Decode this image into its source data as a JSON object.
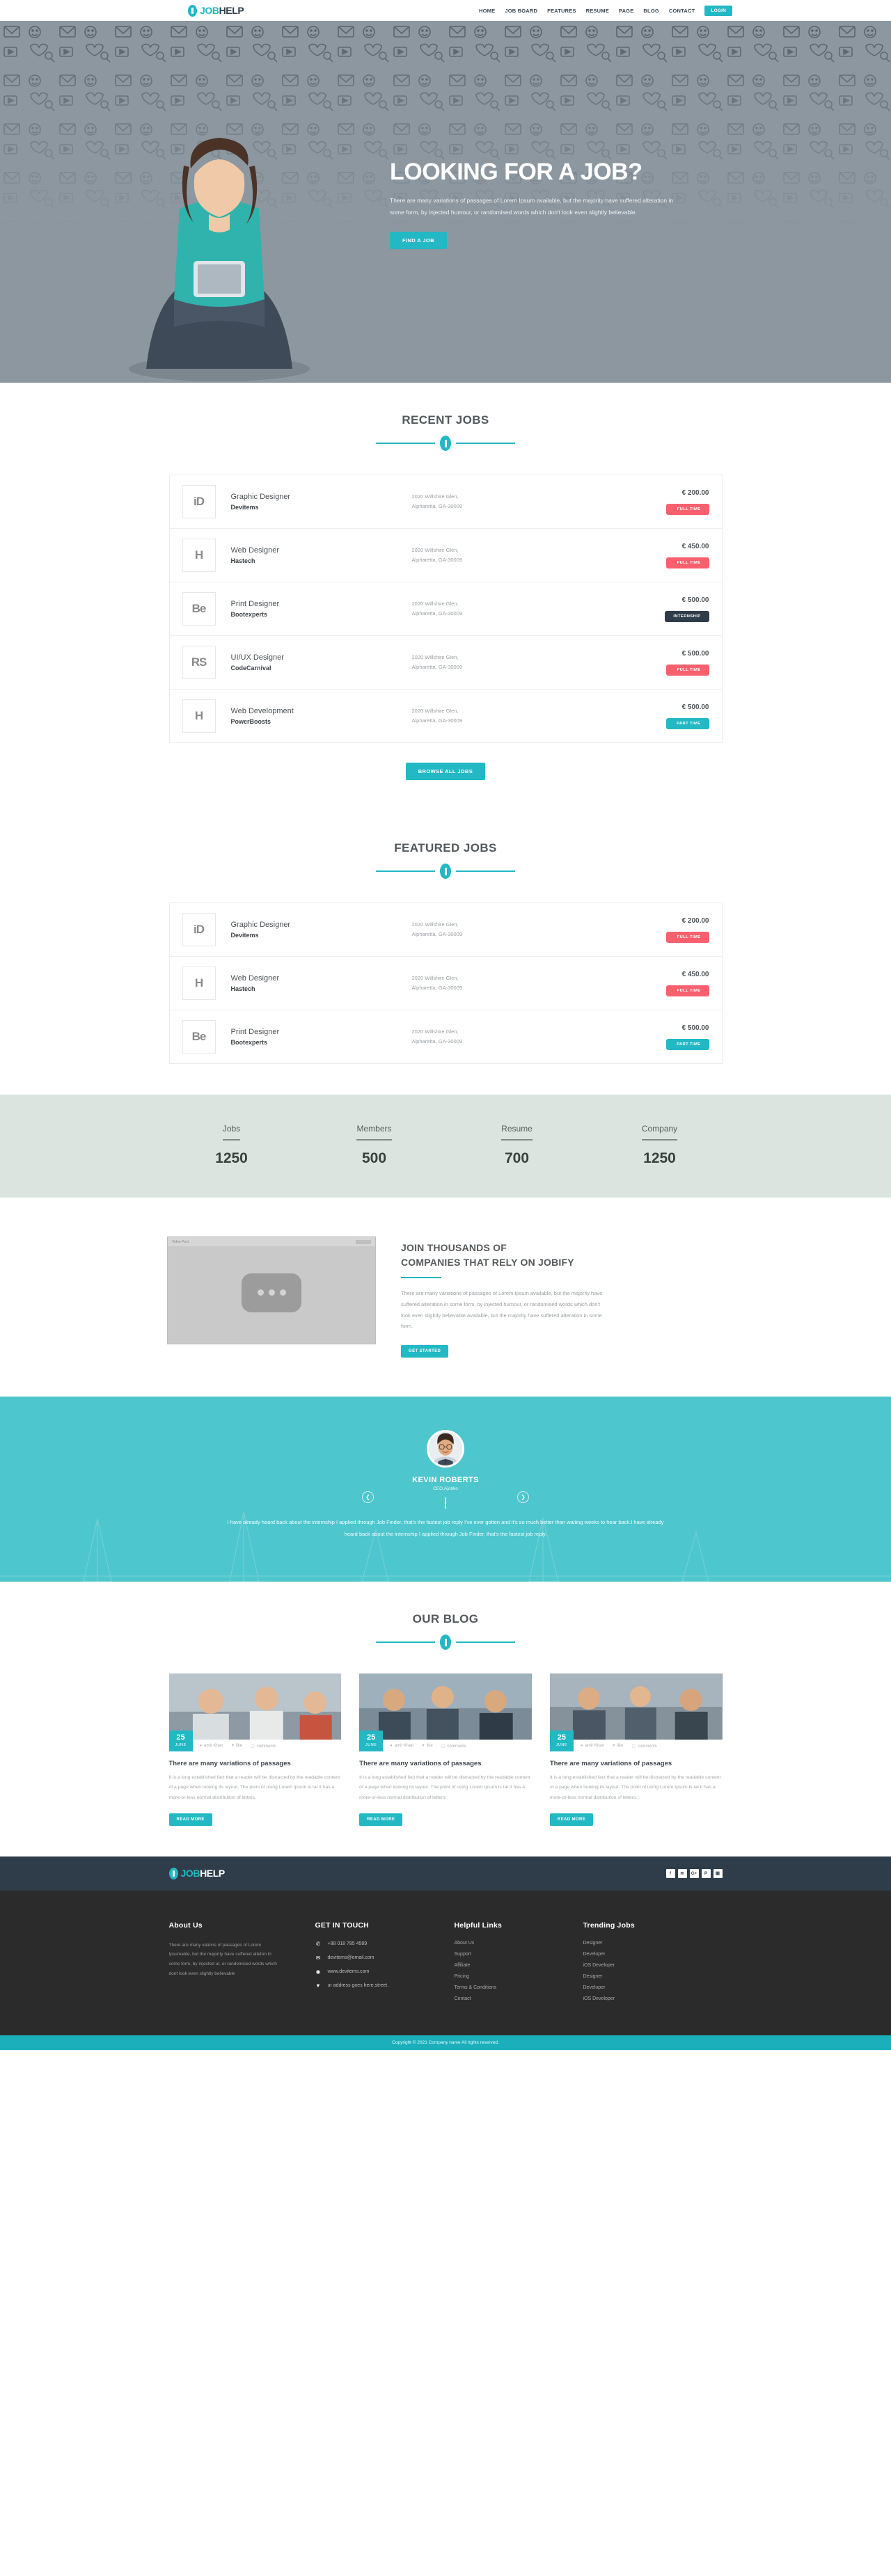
{
  "brand": {
    "part1": "JOB",
    "part2": "HELP",
    "icon": "tie-icon"
  },
  "nav": {
    "items": [
      {
        "label": "HOME"
      },
      {
        "label": "JOB BOARD"
      },
      {
        "label": "FEATURES"
      },
      {
        "label": "RESUME"
      },
      {
        "label": "PAGE"
      },
      {
        "label": "BLOG"
      },
      {
        "label": "CONTACT"
      }
    ],
    "login_label": "LOGIN"
  },
  "hero": {
    "title": "LOOKING FOR A JOB?",
    "paragraph": "There are many variations of passages of Lorem Ipsum available, but the majority have suffered alteration in some form, by injected humour, or randomised words which don't look even slightly believable.",
    "cta_label": "FIND A JOB"
  },
  "recent_jobs": {
    "title": "RECENT JOBS",
    "browse_label": "BROWSE ALL JOBS",
    "rows": [
      {
        "logo": "iD",
        "title": "Graphic Designer",
        "company": "Devitems",
        "address_line1": "2020 Willshire Glen,",
        "address_line2": "Alpharetta, GA-30009",
        "price": "€ 200.00",
        "tag": "FULL TIME",
        "tag_type": "fulltime"
      },
      {
        "logo": "H",
        "title": "Web Designer",
        "company": "Hastech",
        "address_line1": "2020 Willshire Glen,",
        "address_line2": "Alpharetta, GA-30009",
        "price": "€ 450.00",
        "tag": "FULL TIME",
        "tag_type": "fulltime"
      },
      {
        "logo": "Be",
        "title": "Print Designer",
        "company": "Bootexperts",
        "address_line1": "2020 Willshire Glen,",
        "address_line2": "Alpharetta, GA-30009",
        "price": "€ 500.00",
        "tag": "INTERNSHIP",
        "tag_type": "internship"
      },
      {
        "logo": "RS",
        "title": "UI/UX Designer",
        "company": "CodeCarnival",
        "address_line1": "2020 Willshire Glen,",
        "address_line2": "Alpharetta, GA-30009",
        "price": "€ 500.00",
        "tag": "FULL TIME",
        "tag_type": "fulltime"
      },
      {
        "logo": "H",
        "title": "Web Development",
        "company": "PowerBoosts",
        "address_line1": "2020 Willshire Glen,",
        "address_line2": "Alpharetta, GA-30009",
        "price": "€ 500.00",
        "tag": "PART TIME",
        "tag_type": "parttime"
      }
    ]
  },
  "featured_jobs": {
    "title": "FEATURED JOBS",
    "rows": [
      {
        "logo": "iD",
        "title": "Graphic Designer",
        "company": "Devitems",
        "address_line1": "2020 Willshire Glen,",
        "address_line2": "Alpharetta, GA-30009",
        "price": "€ 200.00",
        "tag": "FULL TIME",
        "tag_type": "fulltime"
      },
      {
        "logo": "H",
        "title": "Web Designer",
        "company": "Hastech",
        "address_line1": "2020 Willshire Glen,",
        "address_line2": "Alpharetta, GA-30009",
        "price": "€ 450.00",
        "tag": "FULL TIME",
        "tag_type": "fulltime"
      },
      {
        "logo": "Be",
        "title": "Print Designer",
        "company": "Bootexperts",
        "address_line1": "2020 Willshire Glen,",
        "address_line2": "Alpharetta, GA-30009",
        "price": "€ 500.00",
        "tag": "PART TIME",
        "tag_type": "parttime"
      }
    ]
  },
  "counters": [
    {
      "label": "Jobs",
      "value": "1250"
    },
    {
      "label": "Members",
      "value": "500"
    },
    {
      "label": "Resume",
      "value": "700"
    },
    {
      "label": "Company",
      "value": "1250"
    }
  ],
  "video_cta": {
    "player_label": "Video Post",
    "heading_line1": "JOIN THOUSANDS OF",
    "heading_line2": "COMPANIES THAT RELY ON JOBIFY",
    "paragraph": "There are many variations of passages of Lorem Ipsum available, but the majority have suffered alteration in some form, by injected humour, or randomised words which don't look even slightly believable.available, but the majority have suffered alteration in some form.",
    "cta_label": "GET STARTED"
  },
  "testimonial": {
    "name": "KEVIN ROBERTS",
    "role": "CEO,Ajobko",
    "quote": "I have already heard back about the internship I applied through Job Finder, that's the fastest job reply I've ever gotten and it's so much better than waiting weeks to hear back.I have already heard back about the internship I applied through Job Finder, that's the fastest job reply.",
    "prev_icon": "chevron-left-icon",
    "next_icon": "chevron-right-icon"
  },
  "blog": {
    "title": "OUR BLOG",
    "posts": [
      {
        "day": "25",
        "month": "JUNE",
        "author": "amir Khan",
        "likes": "like",
        "comments": "comments",
        "title": "There are many variations of passages",
        "excerpt": "It is a long established fact that a reader will be distracted by the readable content of a page when looking its layout. The point of using Lorem Ipsum is tat it has a more-or-less normal distribution of letters.",
        "read_more": "READ MORE"
      },
      {
        "day": "25",
        "month": "JUNE",
        "author": "amir Khan",
        "likes": "like",
        "comments": "comments",
        "title": "There are many variations of passages",
        "excerpt": "It is a long established fact that a reader will be distracted by the readable content of a page when looking its layout. The point of using Lorem Ipsum is tat it has a more-or-less normal distribution of letters.",
        "read_more": "READ MORE"
      },
      {
        "day": "25",
        "month": "JUNE",
        "author": "amir Khan",
        "likes": "like",
        "comments": "comments",
        "title": "There are many variations of passages",
        "excerpt": "It is a long established fact that a reader will be distracted by the readable content of a page when looking its layout. The point of using Lorem Ipsum is tat it has a more-or-less normal distribution of letters.",
        "read_more": "READ MORE"
      }
    ]
  },
  "footer": {
    "socials": [
      {
        "icon": "facebook-icon",
        "glyph": "f"
      },
      {
        "icon": "rss-icon",
        "glyph": "≋"
      },
      {
        "icon": "google-plus-icon",
        "glyph": "G+"
      },
      {
        "icon": "pinterest-icon",
        "glyph": "P"
      },
      {
        "icon": "instagram-icon",
        "glyph": "▣"
      }
    ],
    "about": {
      "heading": "About Us",
      "text": "There are many vations of passages of Lorem Ipsumable, but the majority have suffered alteton in some form, by injected ur, or randomised words which dont look even slightly believable"
    },
    "contact": {
      "heading": "GET IN TOUCH",
      "items": [
        {
          "icon": "phone-icon",
          "glyph": "✆",
          "text": "+88 018 785 4589"
        },
        {
          "icon": "mail-icon",
          "glyph": "✉",
          "text": "devitems@email.com"
        },
        {
          "icon": "globe-icon",
          "glyph": "◉",
          "text": "www.devitems.com"
        },
        {
          "icon": "pin-icon",
          "glyph": "▼",
          "text": "ur address goes here,street."
        }
      ]
    },
    "helpful": {
      "heading": "Helpful Links",
      "items": [
        "About Us",
        "Support",
        "Affiliate",
        "Pricing",
        "Terms & Conditions",
        "Contact"
      ]
    },
    "trending": {
      "heading": "Trending Jobs",
      "items": [
        "Designer",
        "Developer",
        "iOS Developer",
        "Designer",
        "Developer",
        "iOS Developer"
      ]
    },
    "copyright": "Copyright © 2021 Company name All rights reserved."
  },
  "colors": {
    "accent": "#22b8c4",
    "dark": "#2e3d49",
    "danger": "#f9606e",
    "footer_bg": "#2b2b2b",
    "counter_bg": "#dbe4de",
    "testimonial_bg": "#4ec6cd"
  }
}
